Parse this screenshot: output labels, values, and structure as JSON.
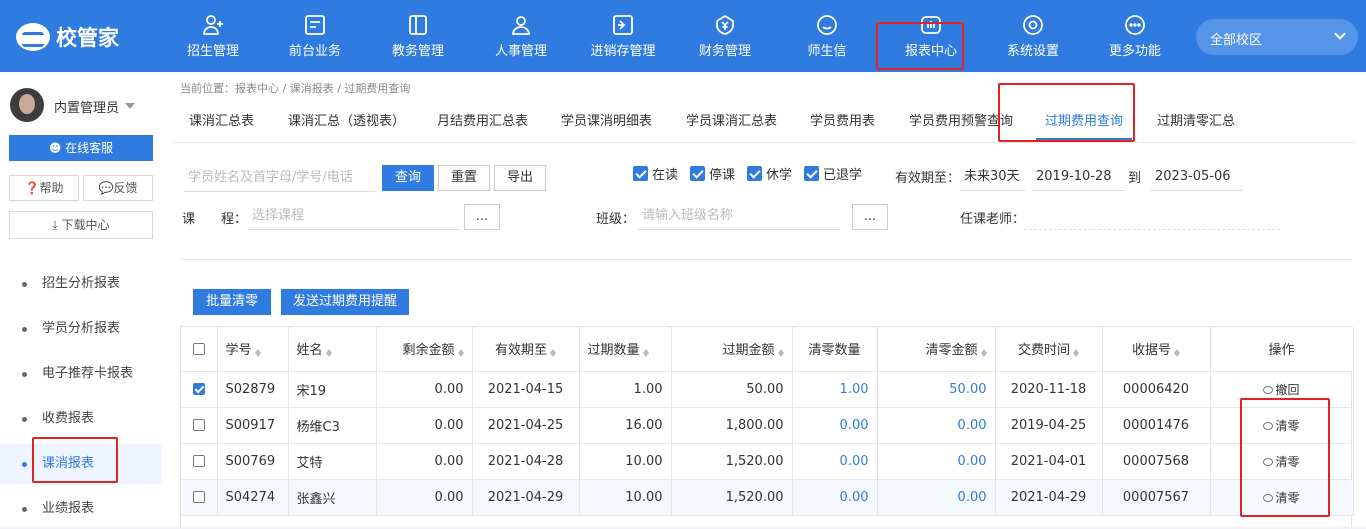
{
  "app": {
    "logo_text": "校管家"
  },
  "topnav": [
    {
      "label": "招生管理",
      "icon": "user-plus-icon"
    },
    {
      "label": "前台业务",
      "icon": "reception-icon"
    },
    {
      "label": "教务管理",
      "icon": "book-icon"
    },
    {
      "label": "人事管理",
      "icon": "person-icon"
    },
    {
      "label": "进销存管理",
      "icon": "inventory-icon"
    },
    {
      "label": "财务管理",
      "icon": "finance-icon"
    },
    {
      "label": "师生信",
      "icon": "message-icon"
    },
    {
      "label": "报表中心",
      "icon": "report-icon",
      "active": true
    },
    {
      "label": "系统设置",
      "icon": "settings-icon"
    },
    {
      "label": "更多功能",
      "icon": "more-icon"
    }
  ],
  "campus": {
    "label": "全部校区"
  },
  "sidebar": {
    "username": "内置管理员",
    "service_label": "在线客服",
    "help_label": "帮助",
    "feedback_label": "反馈",
    "download_label": "下载中心",
    "items": [
      {
        "label": "招生分析报表"
      },
      {
        "label": "学员分析报表"
      },
      {
        "label": "电子推荐卡报表"
      },
      {
        "label": "收费报表"
      },
      {
        "label": "课消报表",
        "active": true
      },
      {
        "label": "业绩报表"
      }
    ]
  },
  "breadcrumb": "当前位置：报表中心 / 课消报表 / 过期费用查询",
  "tabs": [
    {
      "label": "课消汇总表"
    },
    {
      "label": "课消汇总（透视表）"
    },
    {
      "label": "月结费用汇总表"
    },
    {
      "label": "学员课消明细表"
    },
    {
      "label": "学员课消汇总表"
    },
    {
      "label": "学员费用表"
    },
    {
      "label": "学员费用预警查询"
    },
    {
      "label": "过期费用查询",
      "active": true
    },
    {
      "label": "过期清零汇总"
    }
  ],
  "filters": {
    "search_placeholder": "学员姓名及首字母/学号/电话",
    "query_button": "查询",
    "reset_button": "重置",
    "export_button": "导出",
    "status_checks": [
      "在读",
      "停课",
      "休学",
      "已退学"
    ],
    "expiry_label": "有效期至：",
    "expiry_range_value": "未来30天",
    "date_from": "2019-10-28",
    "to_label": "到",
    "date_to": "2023-05-06",
    "course_label": "课　　程：",
    "course_placeholder": "选择课程",
    "ellipsis": "...",
    "class_label": "班级：",
    "class_placeholder": "请输入班级名称",
    "teacher_label": "任课老师："
  },
  "actions": {
    "batch_clear": "批量清零",
    "send_reminder": "发送过期费用提醒"
  },
  "table": {
    "headers": [
      "学号",
      "姓名",
      "剩余金额",
      "有效期至",
      "过期数量",
      "过期金额",
      "清零数量",
      "清零金额",
      "交费时间",
      "收据号",
      "操作"
    ],
    "rows": [
      {
        "checked": true,
        "id": "S02879",
        "name": "宋19",
        "remaining": "0.00",
        "expiry": "2021-04-15",
        "expired_qty": "1.00",
        "expired_amt": "50.00",
        "cleared_qty": "1.00",
        "cleared_amt": "50.00",
        "pay_date": "2020-11-18",
        "receipt": "00006420",
        "op": "撤回"
      },
      {
        "checked": false,
        "id": "S00917",
        "name": "杨维C3",
        "remaining": "0.00",
        "expiry": "2021-04-25",
        "expired_qty": "16.00",
        "expired_amt": "1,800.00",
        "cleared_qty": "0.00",
        "cleared_amt": "0.00",
        "pay_date": "2019-04-25",
        "receipt": "00001476",
        "op": "清零"
      },
      {
        "checked": false,
        "id": "S00769",
        "name": "艾特",
        "remaining": "0.00",
        "expiry": "2021-04-28",
        "expired_qty": "10.00",
        "expired_amt": "1,520.00",
        "cleared_qty": "0.00",
        "cleared_amt": "0.00",
        "pay_date": "2021-04-01",
        "receipt": "00007568",
        "op": "清零"
      },
      {
        "checked": false,
        "id": "S04274",
        "name": "张鑫兴",
        "remaining": "0.00",
        "expiry": "2021-04-29",
        "expired_qty": "10.00",
        "expired_amt": "1,520.00",
        "cleared_qty": "0.00",
        "cleared_amt": "0.00",
        "pay_date": "2021-04-29",
        "receipt": "00007567",
        "op": "清零"
      }
    ]
  },
  "colors": {
    "primary": "#2f7be0",
    "highlight": "#e02424"
  }
}
